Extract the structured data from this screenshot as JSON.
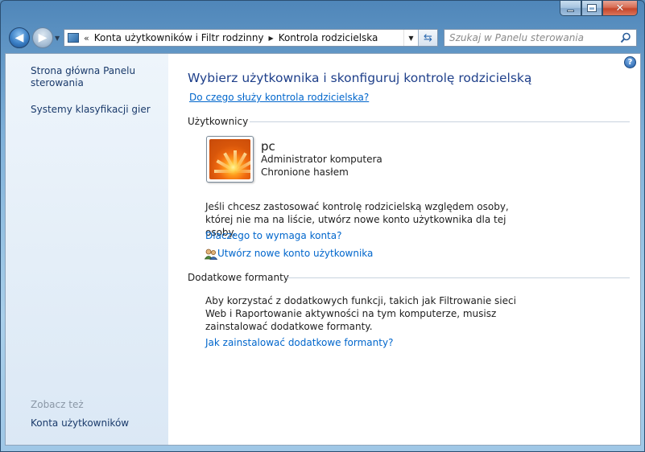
{
  "window": {
    "caption_buttons": {
      "minimize": "minimize-icon",
      "maximize": "maximize-icon",
      "close": "close-icon"
    }
  },
  "nav": {
    "breadcrumb": [
      {
        "label": "Konta użytkowników i Filtr rodzinny"
      },
      {
        "label": "Kontrola rodzicielska"
      }
    ],
    "search_placeholder": "Szukaj w Panelu sterowania"
  },
  "sidebar": {
    "items": [
      {
        "label": "Strona główna Panelu sterowania"
      },
      {
        "label": "Systemy klasyfikacji gier"
      }
    ],
    "see_also_title": "Zobacz też",
    "see_also": [
      {
        "label": "Konta użytkowników"
      }
    ]
  },
  "main": {
    "title": "Wybierz użytkownika i skonfiguruj kontrolę rodzicielską",
    "help_link": "Do czego służy kontrola rodzicielska?",
    "users_section": "Użytkownicy",
    "user": {
      "name": "pc",
      "role": "Administrator komputera",
      "password": "Chronione hasłem"
    },
    "no_user_text": "Jeśli chcesz zastosować kontrolę rodzicielską względem osoby, której nie ma na liście, utwórz nowe konto użytkownika dla tej osoby.",
    "why_account_link": "Dlaczego to wymaga konta?",
    "create_account_link": "Utwórz nowe konto użytkownika",
    "extra_section": "Dodatkowe formanty",
    "extra_text": "Aby korzystać z dodatkowych funkcji, takich jak Filtrowanie sieci Web i Raportowanie aktywności na tym komputerze, musisz zainstalować dodatkowe formanty.",
    "install_link": "Jak zainstalować dodatkowe formanty?"
  }
}
